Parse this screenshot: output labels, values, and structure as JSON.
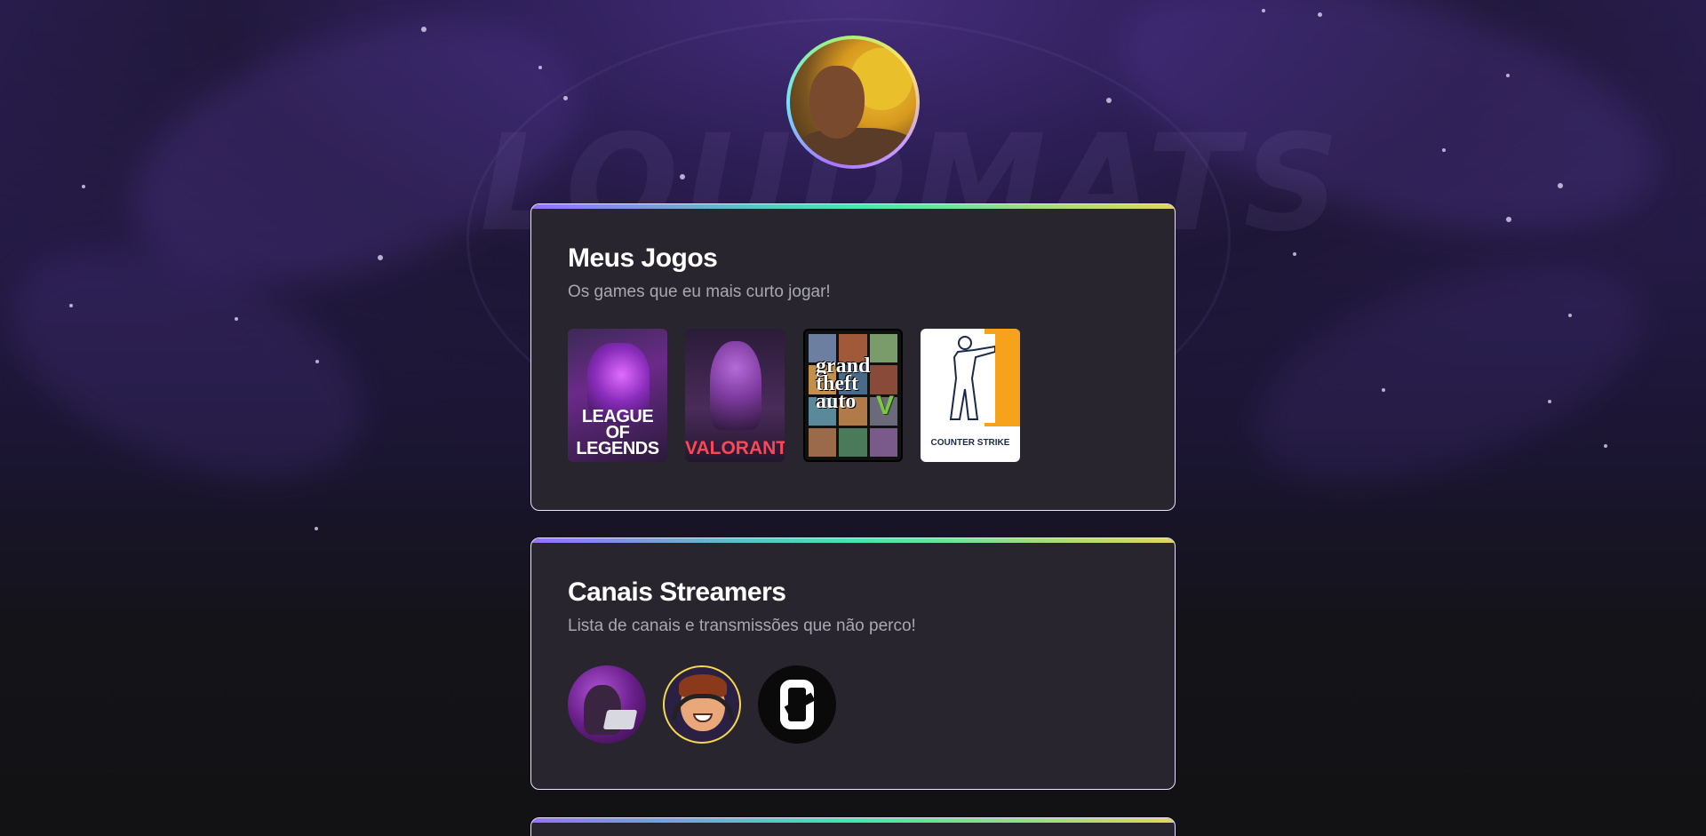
{
  "profile": {
    "avatar_alt": "Foto de perfil"
  },
  "background": {
    "watermark_text": "LOUDMATS"
  },
  "games_card": {
    "title": "Meus Jogos",
    "subtitle": "Os games que eu mais curto jogar!",
    "games": [
      {
        "name": "League of Legends",
        "cover_text": "LEAGUE OF LEGENDS"
      },
      {
        "name": "Valorant",
        "cover_text": "VALORANT"
      },
      {
        "name": "Grand Theft Auto V",
        "cover_text": "grand theft auto"
      },
      {
        "name": "Counter-Strike",
        "cover_text": "COUNTER STRIKE"
      }
    ]
  },
  "streamers_card": {
    "title": "Canais Streamers",
    "subtitle": "Lista de canais e transmissões que não perco!",
    "streamers": [
      {
        "icon": "streamer-laptop-avatar"
      },
      {
        "icon": "streamer-cartoon-avatar"
      },
      {
        "icon": "streamer-logo-avatar"
      }
    ]
  },
  "colors": {
    "card_background": "#29252f",
    "card_border_gradient": [
      "#9572fc",
      "#43e7ad",
      "#e1d55d"
    ],
    "title": "#ffffff",
    "subtitle": "#a8a8b3",
    "page_background": "#121214",
    "accent_purple": "#2c1f55"
  }
}
